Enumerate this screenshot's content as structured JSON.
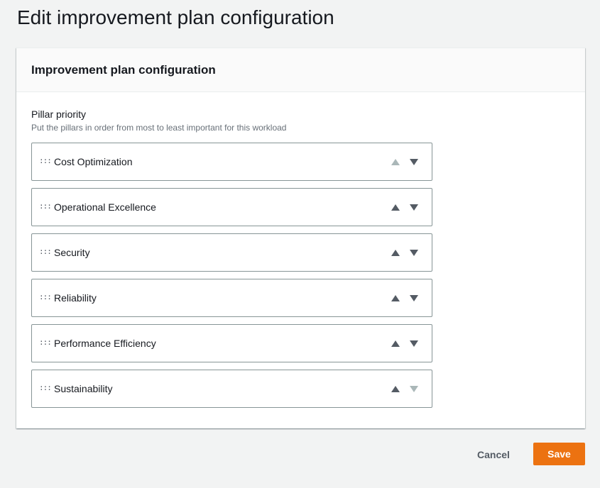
{
  "page": {
    "title": "Edit improvement plan configuration"
  },
  "panel": {
    "title": "Improvement plan configuration",
    "field_label": "Pillar priority",
    "field_description": "Put the pillars in order from most to least important for this workload"
  },
  "pillars": [
    {
      "label": "Cost Optimization",
      "up_enabled": false,
      "down_enabled": true
    },
    {
      "label": "Operational Excellence",
      "up_enabled": true,
      "down_enabled": true
    },
    {
      "label": "Security",
      "up_enabled": true,
      "down_enabled": true
    },
    {
      "label": "Reliability",
      "up_enabled": true,
      "down_enabled": true
    },
    {
      "label": "Performance Efficiency",
      "up_enabled": true,
      "down_enabled": true
    },
    {
      "label": "Sustainability",
      "up_enabled": true,
      "down_enabled": false
    }
  ],
  "icons": {
    "drag_handle": "drag-handle-icon",
    "move_up": "triangle-up-icon",
    "move_down": "triangle-down-icon"
  },
  "actions": {
    "cancel_label": "Cancel",
    "save_label": "Save"
  },
  "colors": {
    "primary": "#ec7211",
    "background": "#f2f3f3",
    "border": "#879596",
    "icon_enabled": "#545b64",
    "icon_disabled": "#aab7b8"
  }
}
